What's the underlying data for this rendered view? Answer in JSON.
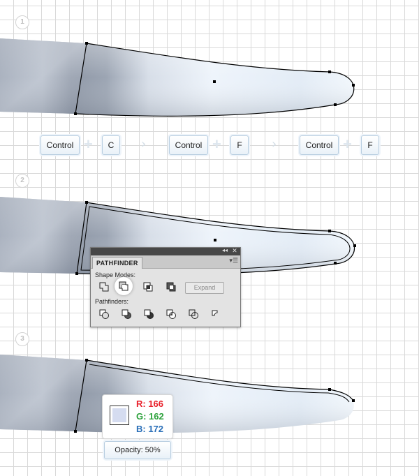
{
  "steps": [
    "1",
    "2",
    "3"
  ],
  "shortcuts": [
    {
      "first": "Control",
      "second": "C"
    },
    {
      "first": "Control",
      "second": "F"
    },
    {
      "first": "Control",
      "second": "F"
    }
  ],
  "pathfinder": {
    "title": "PATHFINDER",
    "shape_modes_label": "Shape Modes:",
    "pathfinders_label": "Pathfinders:",
    "expand_label": "Expand",
    "shape_mode_icons": [
      "unite-icon",
      "minus-front-icon",
      "intersect-icon",
      "exclude-icon"
    ],
    "pathfinder_icons": [
      "divide-icon",
      "trim-icon",
      "merge-icon",
      "crop-icon",
      "outline-icon",
      "minus-back-icon"
    ]
  },
  "color_info": {
    "r_label": "R: 166",
    "g_label": "G: 162",
    "b_label": "B: 172",
    "swatch_color": "#d5dcf0",
    "r_color": "#e8212b",
    "g_color": "#2da23c",
    "b_color": "#2a6fb8",
    "opacity_label": "Opacity: 50%"
  },
  "colors": {
    "blade_dark": "#7c8594",
    "blade_light": "#e9f0f8",
    "outline": "#000000"
  }
}
